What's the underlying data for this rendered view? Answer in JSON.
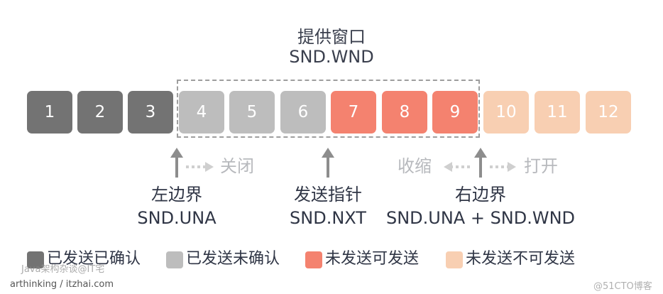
{
  "window": {
    "title_cn": "提供窗口",
    "title_en": "SND.WND"
  },
  "cells": [
    {
      "label": "1",
      "color": "#737373"
    },
    {
      "label": "2",
      "color": "#737373"
    },
    {
      "label": "3",
      "color": "#737373"
    },
    {
      "label": "4",
      "color": "#bdbdbd"
    },
    {
      "label": "5",
      "color": "#bdbdbd"
    },
    {
      "label": "6",
      "color": "#bdbdbd"
    },
    {
      "label": "7",
      "color": "#f4826f"
    },
    {
      "label": "8",
      "color": "#f4826f"
    },
    {
      "label": "9",
      "color": "#f4826f"
    },
    {
      "label": "10",
      "color": "#f8cfb2"
    },
    {
      "label": "11",
      "color": "#f8cfb2"
    },
    {
      "label": "12",
      "color": "#f8cfb2"
    }
  ],
  "pointers": {
    "left": {
      "cn": "左边界",
      "en": "SND.UNA"
    },
    "next": {
      "cn": "发送指针",
      "en": "SND.NXT"
    },
    "right": {
      "cn": "右边界",
      "en": "SND.UNA + SND.WND"
    }
  },
  "moves": {
    "close": "关闭",
    "shrink": "收缩",
    "open": "打开"
  },
  "legend": [
    {
      "label": "已发送已确认",
      "color": "#737373"
    },
    {
      "label": "已发送未确认",
      "color": "#bdbdbd"
    },
    {
      "label": "未发送可发送",
      "color": "#f4826f"
    },
    {
      "label": "未发送不可发送",
      "color": "#f8cfb2"
    }
  ],
  "watermarks": {
    "line1": "Java架构杂谈@IT宅",
    "line2": "arthinking / itzhai.com",
    "corner": "@51CTO博客"
  },
  "colors": {
    "arrow": "#8d8d8d",
    "dotted_arrow": "#cfcfcf",
    "window_border": "#9e9e9e"
  }
}
